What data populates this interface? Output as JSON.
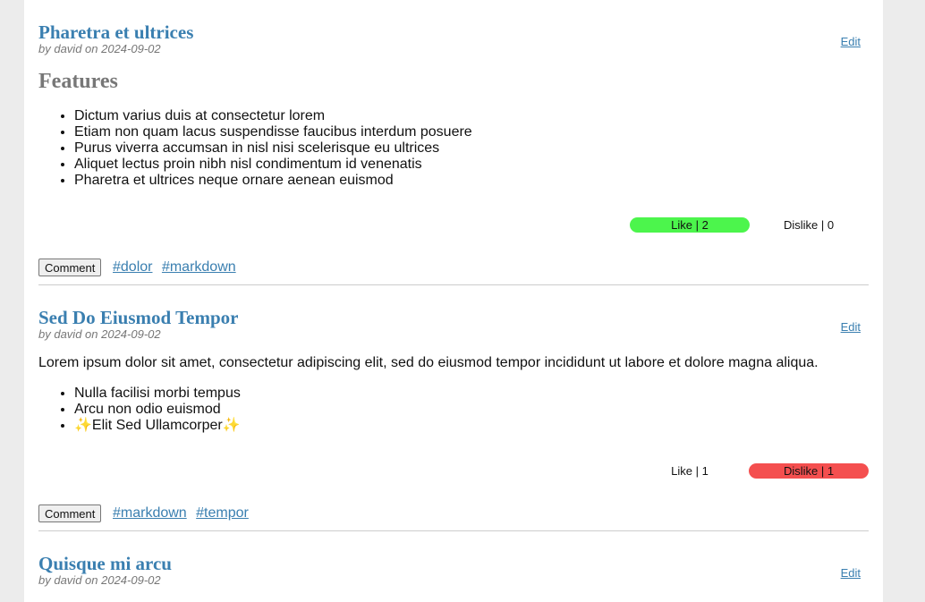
{
  "posts": [
    {
      "title": "Pharetra et ultrices",
      "meta": "by david on 2024-09-02",
      "edit": "Edit",
      "heading": "Features",
      "items": [
        "Dictum varius duis at consectetur lorem",
        "Etiam non quam lacus suspendisse faucibus interdum posuere",
        "Purus viverra accumsan in nisl nisi scelerisque eu ultrices",
        "Aliquet lectus proin nibh nisl condimentum id venenatis",
        "Pharetra et ultrices neque ornare aenean euismod"
      ],
      "like_label": "Like | 2",
      "dislike_label": "Dislike | 0",
      "comment_label": "Comment",
      "tags": [
        "#dolor",
        "#markdown"
      ]
    },
    {
      "title": "Sed Do Eiusmod Tempor",
      "meta": "by david on 2024-09-02",
      "edit": "Edit",
      "paragraph": "Lorem ipsum dolor sit amet, consectetur adipiscing elit, sed do eiusmod tempor incididunt ut labore et dolore magna aliqua.",
      "items": [
        "Nulla facilisi morbi tempus",
        "Arcu non odio euismod",
        "✨Elit Sed Ullamcorper✨"
      ],
      "like_label": "Like | 1",
      "dislike_label": "Dislike | 1",
      "comment_label": "Comment",
      "tags": [
        "#markdown",
        "#tempor"
      ]
    },
    {
      "title": "Quisque mi arcu",
      "meta": "by david on 2024-09-02",
      "edit": "Edit"
    }
  ],
  "colors": {
    "link": "#3a7fb0",
    "like_active": "#4cf54c",
    "dislike_active": "#f44f4f",
    "background": "#ececec"
  }
}
